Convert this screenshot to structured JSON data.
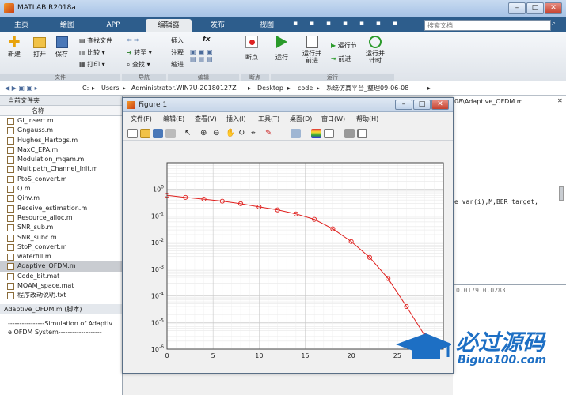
{
  "window": {
    "title": "MATLAB R2018a"
  },
  "tabs": [
    "主页",
    "绘图",
    "APP",
    "编辑器",
    "发布",
    "视图"
  ],
  "search": {
    "placeholder": "搜索文档"
  },
  "ribbon": {
    "file": {
      "new": "新建",
      "open": "打开",
      "save": "保存",
      "find_files": "查找文件",
      "compare": "比较",
      "print": "打印",
      "group": "文件"
    },
    "nav": {
      "goto": "转至",
      "find": "查找",
      "group": "导航"
    },
    "edit": {
      "insert": "插入",
      "comment": "注释",
      "indent": "缩进",
      "fx": "fx",
      "group": "编辑"
    },
    "bp": {
      "breakpoints": "断点",
      "group": "断点"
    },
    "run": {
      "run": "运行",
      "run_advance": "运行并\n前进",
      "run_section": "运行节",
      "advance": "前进",
      "run_time": "运行并\n计时",
      "group": "运行"
    }
  },
  "address": {
    "segments": [
      "C:",
      "Users",
      "Administrator.WIN7U-20180127Z",
      "Desktop",
      "code",
      "系统仿真平台_整理09-06-08"
    ]
  },
  "current_folder": {
    "title": "当前文件夹",
    "column": "名称",
    "files": [
      "GI_insert.m",
      "Gngauss.m",
      "Hughes_Hartogs.m",
      "MaxC_EPA.m",
      "Modulation_mqam.m",
      "Multipath_Channel_Init.m",
      "PtoS_convert.m",
      "Q.m",
      "Qinv.m",
      "Receive_estimation.m",
      "Resource_alloc.m",
      "SNR_sub.m",
      "SNR_subc.m",
      "StoP_convert.m",
      "waterfill.m",
      "Adaptive_OFDM.m",
      "Code_bit.mat",
      "MQAM_space.mat",
      "程序改动说明.txt"
    ],
    "selected": "Adaptive_OFDM.m",
    "details_title": "Adaptive_OFDM.m  (脚本)",
    "details_text": "----------------Simulation of Adaptive OFDM System-------------------"
  },
  "editor": {
    "path": "08\\Adaptive_OFDM.m",
    "code_line": "e_var(i),M,BER_target,",
    "cmd_line": "0.0179   0.0283"
  },
  "figure": {
    "title": "Figure 1",
    "menu": [
      "文件(F)",
      "编辑(E)",
      "查看(V)",
      "插入(I)",
      "工具(T)",
      "桌面(D)",
      "窗口(W)",
      "帮助(H)"
    ]
  },
  "chart_data": {
    "type": "line",
    "title": "",
    "xlabel": "",
    "ylabel": "",
    "xlim": [
      0,
      30
    ],
    "ylim": [
      1e-06,
      10
    ],
    "yscale": "log",
    "grid": true,
    "xticks": [
      0,
      5,
      10,
      15,
      20,
      25
    ],
    "yticks": [
      "10^0",
      "10^-1",
      "10^-2",
      "10^-3",
      "10^-4",
      "10^-5",
      "10^-6"
    ],
    "series": [
      {
        "color": "#e0201e",
        "marker": "circle",
        "x": [
          0,
          2,
          4,
          6,
          8,
          10,
          12,
          14,
          16,
          18,
          20,
          22,
          24,
          26,
          28,
          30
        ],
        "y": [
          0.6,
          0.5,
          0.43,
          0.36,
          0.29,
          0.22,
          0.17,
          0.12,
          0.075,
          0.033,
          0.011,
          0.0028,
          0.00045,
          4e-05,
          3.2e-06,
          2e-07
        ]
      }
    ]
  },
  "watermark": {
    "text": "必过源码",
    "sub": "Biguo100.com"
  },
  "colors": {
    "accent": "#2d5d8c",
    "series": "#e0201e"
  }
}
